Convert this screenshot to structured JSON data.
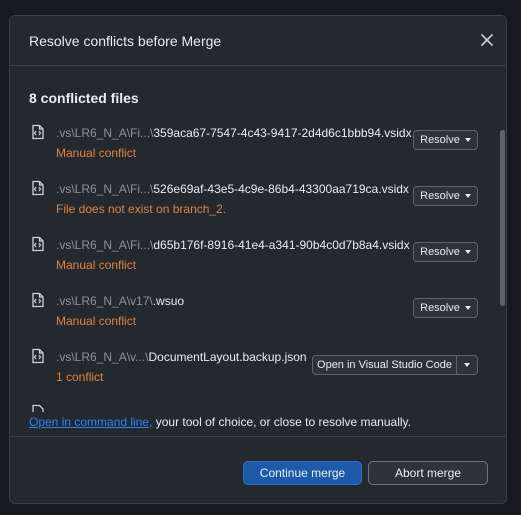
{
  "dialog": {
    "title": "Resolve conflicts before Merge",
    "close_icon": "close-icon"
  },
  "summary": {
    "count_label": "8 conflicted files"
  },
  "files": [
    {
      "dir": ".vs\\LR6_N_A\\Fi...\\",
      "name": "359aca67-7547-4c43-9417-2d4d6c1bbb94.vsidx",
      "status": "Manual conflict",
      "action": "Resolve"
    },
    {
      "dir": ".vs\\LR6_N_A\\Fi...\\",
      "name": "526e69af-43e5-4c9e-86b4-43300aa719ca.vsidx",
      "status": "File does not exist on branch_2.",
      "action": "Resolve"
    },
    {
      "dir": ".vs\\LR6_N_A\\Fi...\\",
      "name": "d65b176f-8916-41e4-a341-90b4c0d7b8a4.vsidx",
      "status": "Manual conflict",
      "action": "Resolve"
    },
    {
      "dir": ".vs\\LR6_N_A\\v17\\",
      "name": ".wsuo",
      "status": "Manual conflict",
      "action": "Resolve"
    },
    {
      "dir": ".vs\\LR6_N_A\\v...\\",
      "name": "DocumentLayout.backup.json",
      "status": "1 conflict",
      "action": "Open in Visual Studio Code"
    }
  ],
  "footer_text": {
    "link": "Open in command line,",
    "rest": " your tool of choice, or close to resolve manually."
  },
  "buttons": {
    "continue": "Continue merge",
    "abort": "Abort merge"
  },
  "colors": {
    "accent": "#1f5aa8",
    "link": "#2f81f7",
    "warning": "#e0823d",
    "background": "#24292f"
  }
}
